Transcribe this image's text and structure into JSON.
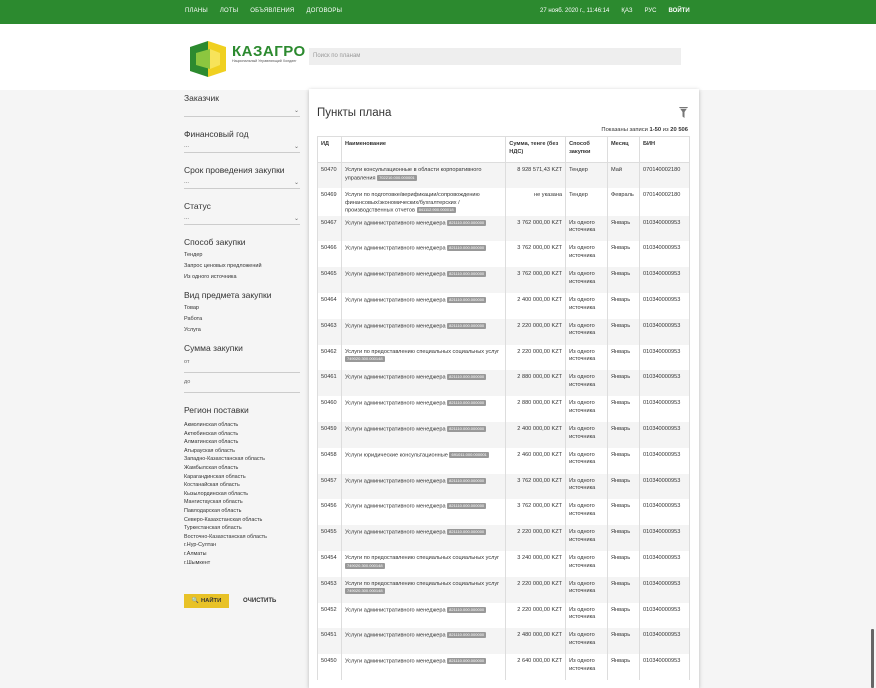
{
  "topbar": {
    "nav": [
      "ПЛАНЫ",
      "ЛОТЫ",
      "ОБЪЯВЛЕНИЯ",
      "ДОГОВОРЫ"
    ],
    "datetime": "27 нояб. 2020 г., 11:46:14",
    "lang_kz": "ҚАЗ",
    "lang_ru": "РУС",
    "login": "ВОЙТИ"
  },
  "header": {
    "logo_name": "КАЗАГРО",
    "logo_tagline": "Национальный Управляющий Холдинг",
    "search_placeholder": "Поиск по планам"
  },
  "sidebar": {
    "customer_label": "Заказчик",
    "year_label": "Финансовый год",
    "year_value": "...",
    "deadline_label": "Срок проведения закупки",
    "deadline_value": "...",
    "status_label": "Статус",
    "status_value": "...",
    "method_label": "Способ закупки",
    "methods": [
      "Тендер",
      "Запрос ценовых предложений",
      "Из одного источника"
    ],
    "subject_label": "Вид предмета закупки",
    "subjects": [
      "Товар",
      "Работа",
      "Услуга"
    ],
    "sum_label": "Сумма закупки",
    "sum_from": "от",
    "sum_to": "до",
    "region_label": "Регион поставки",
    "regions": [
      "Акмолинская область",
      "Актюбинская область",
      "Алматинская область",
      "Атырауская область",
      "Западно-Казахстанская область",
      "Жамбылская область",
      "Карагандинская область",
      "Костанайская область",
      "Кызылординская область",
      "Мангистауская область",
      "Павлодарская область",
      "Северо-Казахстанская область",
      "Туркестанская область",
      "Восточно-Казахстанская область",
      "г.Нур-Султан",
      "г.Алматы",
      "г.Шымкент"
    ],
    "find_button": "НАЙТИ",
    "clear_button": "ОЧИСТИТЬ"
  },
  "panel": {
    "title": "Пункты плана",
    "shown_prefix": "Показаны записи",
    "shown_range": "1-50",
    "shown_of": "из",
    "shown_total": "20 506",
    "columns": [
      "ИД",
      "Наименование",
      "Сумма, тенге (без НДС)",
      "Способ закупки",
      "Месяц",
      "БИН"
    ],
    "rows": [
      {
        "id": "50470",
        "name": "Услуги консультационные в области корпоративного управления",
        "code": "702210.000.000001",
        "sum": "8 928 571,43 KZT",
        "method": "Тендер",
        "month": "Май",
        "bin": "070140002180"
      },
      {
        "id": "50469",
        "name": "Услуги по подготовке/верификации/сопровождению финансовых/экономических/бухгалтерских /производственных отчетов",
        "code": "841112.900.000018",
        "sum": "не указана",
        "method": "Тендер",
        "month": "Февраль",
        "bin": "070140002180"
      },
      {
        "id": "50467",
        "name": "Услуги административного менеджера",
        "code": "821110.000.000000",
        "sum": "3 762 000,00 KZT",
        "method": "Из одного источника",
        "month": "Январь",
        "bin": "010340000953"
      },
      {
        "id": "50466",
        "name": "Услуги административного менеджера",
        "code": "821110.000.000000",
        "sum": "3 762 000,00 KZT",
        "method": "Из одного источника",
        "month": "Январь",
        "bin": "010340000953"
      },
      {
        "id": "50465",
        "name": "Услуги административного менеджера",
        "code": "821110.000.000000",
        "sum": "3 762 000,00 KZT",
        "method": "Из одного источника",
        "month": "Январь",
        "bin": "010340000953"
      },
      {
        "id": "50464",
        "name": "Услуги административного менеджера",
        "code": "821110.000.000000",
        "sum": "2 400 000,00 KZT",
        "method": "Из одного источника",
        "month": "Январь",
        "bin": "010340000953"
      },
      {
        "id": "50463",
        "name": "Услуги административного менеджера",
        "code": "821110.000.000000",
        "sum": "2 220 000,00 KZT",
        "method": "Из одного источника",
        "month": "Январь",
        "bin": "010340000953"
      },
      {
        "id": "50462",
        "name": "Услуги по предоставлению специальных социальных услуг",
        "code": "749020.300.000148",
        "sum": "2 220 000,00 KZT",
        "method": "Из одного источника",
        "month": "Январь",
        "bin": "010340000953"
      },
      {
        "id": "50461",
        "name": "Услуги административного менеджера",
        "code": "821110.000.000000",
        "sum": "2 880 000,00 KZT",
        "method": "Из одного источника",
        "month": "Январь",
        "bin": "010340000953"
      },
      {
        "id": "50460",
        "name": "Услуги административного менеджера",
        "code": "821110.000.000000",
        "sum": "2 880 000,00 KZT",
        "method": "Из одного источника",
        "month": "Январь",
        "bin": "010340000953"
      },
      {
        "id": "50459",
        "name": "Услуги административного менеджера",
        "code": "821110.000.000000",
        "sum": "2 400 000,00 KZT",
        "method": "Из одного источника",
        "month": "Январь",
        "bin": "010340000953"
      },
      {
        "id": "50458",
        "name": "Услуги юридические консультационные",
        "code": "691011.000.000001",
        "sum": "2 460 000,00 KZT",
        "method": "Из одного источника",
        "month": "Январь",
        "bin": "010340000953"
      },
      {
        "id": "50457",
        "name": "Услуги административного менеджера",
        "code": "821110.000.000000",
        "sum": "3 762 000,00 KZT",
        "method": "Из одного источника",
        "month": "Январь",
        "bin": "010340000953"
      },
      {
        "id": "50456",
        "name": "Услуги административного менеджера",
        "code": "821110.000.000000",
        "sum": "3 762 000,00 KZT",
        "method": "Из одного источника",
        "month": "Январь",
        "bin": "010340000953"
      },
      {
        "id": "50455",
        "name": "Услуги административного менеджера",
        "code": "821110.000.000000",
        "sum": "2 220 000,00 KZT",
        "method": "Из одного источника",
        "month": "Январь",
        "bin": "010340000953"
      },
      {
        "id": "50454",
        "name": "Услуги по предоставлению специальных социальных услуг",
        "code": "749020.300.000148",
        "sum": "3 240 000,00 KZT",
        "method": "Из одного источника",
        "month": "Январь",
        "bin": "010340000953"
      },
      {
        "id": "50453",
        "name": "Услуги по предоставлению специальных социальных услуг",
        "code": "749020.300.000148",
        "sum": "2 220 000,00 KZT",
        "method": "Из одного источника",
        "month": "Январь",
        "bin": "010340000953"
      },
      {
        "id": "50452",
        "name": "Услуги административного менеджера",
        "code": "821110.000.000000",
        "sum": "2 220 000,00 KZT",
        "method": "Из одного источника",
        "month": "Январь",
        "bin": "010340000953"
      },
      {
        "id": "50451",
        "name": "Услуги административного менеджера",
        "code": "821110.000.000000",
        "sum": "2 480 000,00 KZT",
        "method": "Из одного источника",
        "month": "Январь",
        "bin": "010340000953"
      },
      {
        "id": "50450",
        "name": "Услуги административного менеджера",
        "code": "821110.000.000000",
        "sum": "2 640 000,00 KZT",
        "method": "Из одного источника",
        "month": "Январь",
        "bin": "010340000953"
      }
    ]
  },
  "colors": {
    "topbar": "#2c8a2f",
    "accent_yellow": "#e8c227",
    "code_badge": "#999999"
  }
}
